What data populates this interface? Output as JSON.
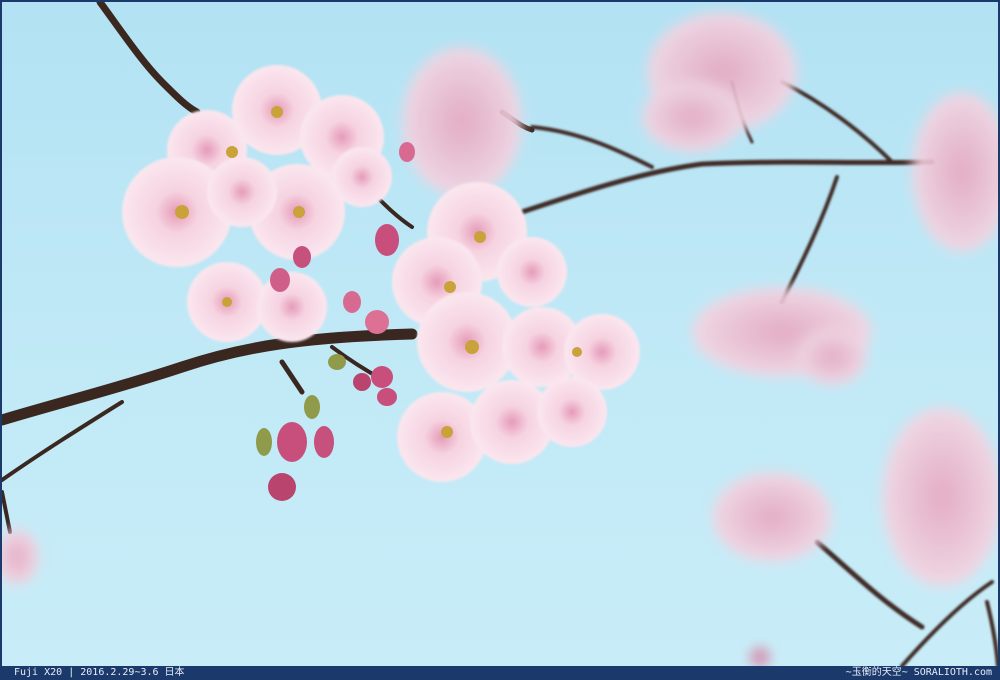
{
  "caption": {
    "camera": "Fuji X20",
    "separator": "|",
    "date_place": "2016.2.29~3.6 日本",
    "credit": "~玉衡的天空~ SORALIOTH.com"
  },
  "scene": {
    "subject": "cherry blossoms on branch",
    "sky_color": "#bfe8f6",
    "petal_color": "#f7d6e2",
    "bud_color": "#c94f7c",
    "branch_color": "#3b2a22",
    "frame_color": "#1b3a6b"
  }
}
